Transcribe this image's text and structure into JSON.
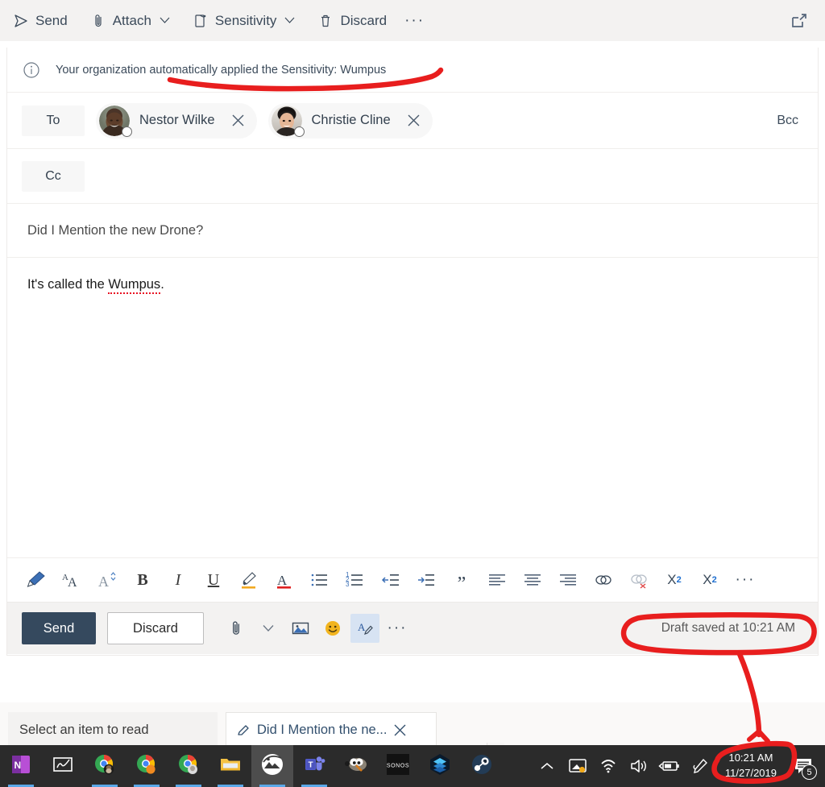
{
  "window": {
    "app": "Outlook Mail Compose"
  },
  "command_bar": {
    "items": [
      {
        "label": "Send",
        "icon": "send-arrow-icon",
        "has_chevron": false
      },
      {
        "label": "Attach",
        "icon": "paperclip-icon",
        "has_chevron": true
      },
      {
        "label": "Sensitivity",
        "icon": "sensitivity-label-icon",
        "has_chevron": true
      },
      {
        "label": "Discard",
        "icon": "trash-icon",
        "has_chevron": false
      }
    ],
    "overflow_label": "···",
    "popout_icon": "open-in-new-window-icon"
  },
  "info_bar": {
    "icon": "info-circle-icon",
    "message": "Your organization automatically applied the Sensitivity: Wumpus"
  },
  "recipients": {
    "to_label": "To",
    "cc_label": "Cc",
    "bcc_label": "Bcc",
    "to": [
      {
        "name": "Nestor Wilke",
        "remove_label": "✕",
        "presence": "offline"
      },
      {
        "name": "Christie Cline",
        "remove_label": "✕",
        "presence": "offline"
      }
    ]
  },
  "message": {
    "subject": "Did I Mention the new Drone?",
    "body_prefix": "It's called the ",
    "body_misspelled": "Wumpus",
    "body_suffix": "."
  },
  "format_toolbar": {
    "buttons": [
      {
        "name": "format-painter-icon",
        "label": ""
      },
      {
        "name": "font-size-icon",
        "label": ""
      },
      {
        "name": "font-grow-icon",
        "label": ""
      },
      {
        "name": "bold-icon",
        "label": "B"
      },
      {
        "name": "italic-icon",
        "label": "I"
      },
      {
        "name": "underline-icon",
        "label": "U"
      },
      {
        "name": "highlight-icon",
        "label": ""
      },
      {
        "name": "font-color-icon",
        "label": "A"
      },
      {
        "name": "bulleted-list-icon",
        "label": ""
      },
      {
        "name": "numbered-list-icon",
        "label": ""
      },
      {
        "name": "decrease-indent-icon",
        "label": ""
      },
      {
        "name": "increase-indent-icon",
        "label": ""
      },
      {
        "name": "quote-icon",
        "label": "”"
      },
      {
        "name": "align-left-icon",
        "label": ""
      },
      {
        "name": "align-center-icon",
        "label": ""
      },
      {
        "name": "align-right-icon",
        "label": ""
      },
      {
        "name": "insert-link-icon",
        "label": ""
      },
      {
        "name": "remove-link-icon",
        "label": ""
      },
      {
        "name": "superscript-icon",
        "label": "X"
      },
      {
        "name": "subscript-icon",
        "label": "X"
      },
      {
        "name": "more-formatting-icon",
        "label": "···"
      }
    ],
    "superscript_exponent": "2",
    "subscript_exponent": "2"
  },
  "action_bar": {
    "send_label": "Send",
    "discard_label": "Discard",
    "icons": [
      {
        "name": "attach-icon"
      },
      {
        "name": "attach-chevron-down-icon"
      },
      {
        "name": "insert-picture-icon"
      },
      {
        "name": "emoji-icon"
      },
      {
        "name": "format-text-icon"
      },
      {
        "name": "more-options-icon"
      }
    ],
    "more_label": "···",
    "draft_status": "Draft saved at 10:21 AM"
  },
  "bottom": {
    "reading_pane_text": "Select an item to read",
    "draft_tab_text": "Did I Mention the ne...",
    "draft_tab_icon": "pencil-icon",
    "draft_tab_close": "✕",
    "scroll_up": "∧",
    "scroll_down": "∨"
  },
  "taskbar": {
    "apps": [
      {
        "name": "onenote-icon",
        "label": "N",
        "open": true,
        "focus": false
      },
      {
        "name": "whiteboard-icon",
        "label": "",
        "open": false,
        "focus": false
      },
      {
        "name": "chrome-profile-1-icon",
        "label": "",
        "open": true,
        "focus": false
      },
      {
        "name": "chrome-profile-2-icon",
        "label": "",
        "open": true,
        "focus": false
      },
      {
        "name": "chrome-profile-3-icon",
        "label": "",
        "open": true,
        "focus": false
      },
      {
        "name": "file-explorer-icon",
        "label": "",
        "open": true,
        "focus": false
      },
      {
        "name": "photos-icon",
        "label": "",
        "open": true,
        "focus": true
      },
      {
        "name": "microsoft-teams-icon",
        "label": "T",
        "open": true,
        "focus": false
      },
      {
        "name": "gimp-icon",
        "label": "",
        "open": false,
        "focus": false
      },
      {
        "name": "sonos-icon",
        "label": "SONOS",
        "open": false,
        "focus": false
      },
      {
        "name": "layers-app-icon",
        "label": "",
        "open": false,
        "focus": false
      },
      {
        "name": "steam-icon",
        "label": "",
        "open": false,
        "focus": false
      }
    ],
    "tray": [
      {
        "name": "show-hidden-icons-chevron-icon"
      },
      {
        "name": "onedrive-camera-icon"
      },
      {
        "name": "wifi-icon"
      },
      {
        "name": "volume-icon"
      },
      {
        "name": "battery-charging-icon"
      },
      {
        "name": "pen-workspace-icon"
      }
    ],
    "clock_time": "10:21 AM",
    "clock_date": "11/27/2019",
    "notification_count": "5"
  },
  "annotations": {
    "color": "#e81e1e",
    "items": [
      {
        "name": "underline-sensitivity-banner",
        "shape": "underline"
      },
      {
        "name": "circle-draft-saved",
        "shape": "ellipse"
      },
      {
        "name": "arrow-draft-to-clock",
        "shape": "arrow"
      },
      {
        "name": "circle-system-clock",
        "shape": "ellipse"
      }
    ]
  }
}
